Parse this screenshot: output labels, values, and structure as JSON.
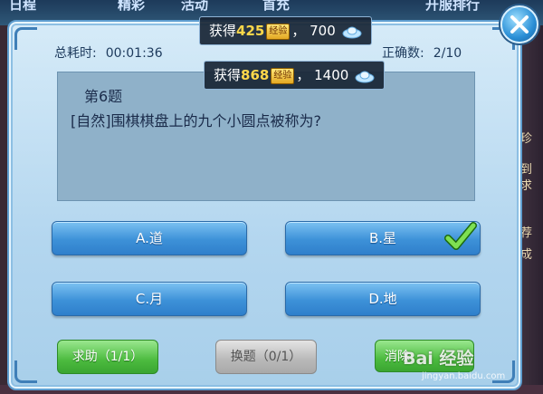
{
  "background": {
    "top_menu": [
      "日程",
      "精彩",
      "活动",
      "首充",
      "开服排行"
    ],
    "side_text": [
      "诗珍",
      "找到",
      "金求",
      "推荐",
      "完成"
    ]
  },
  "stats": {
    "time_label": "总耗时:",
    "time_value": "00:01:36",
    "correct_label": "正确数:",
    "correct_value": "2/10"
  },
  "rewards": [
    {
      "prefix": "获得",
      "exp": "425",
      "exp_badge": "经验",
      "sep": "，",
      "silver": "700"
    },
    {
      "prefix": "获得",
      "exp": "868",
      "exp_badge": "经验",
      "sep": "，",
      "silver": "1400"
    }
  ],
  "question": {
    "number": "第6题",
    "text": "[自然]围棋棋盘上的九个小圆点被称为?"
  },
  "answers": [
    {
      "label": "A.道",
      "selected": false
    },
    {
      "label": "B.星",
      "selected": true
    },
    {
      "label": "C.月",
      "selected": false
    },
    {
      "label": "D.地",
      "selected": false
    }
  ],
  "buttons": {
    "help": "求助（1/1）",
    "swap": "换题（0/1）",
    "clear": "消除"
  },
  "icons": {
    "close": "close-icon",
    "check": "check-icon",
    "silver": "silver-ingot-icon"
  },
  "watermark": {
    "main": "Bai 经验",
    "sub": "jingyan.baidu.com"
  },
  "colors": {
    "answer_blue": "#3d91d8",
    "help_green": "#4cbb3f",
    "exp_yellow": "#ffd84a",
    "check_green": "#3fbf2a"
  }
}
